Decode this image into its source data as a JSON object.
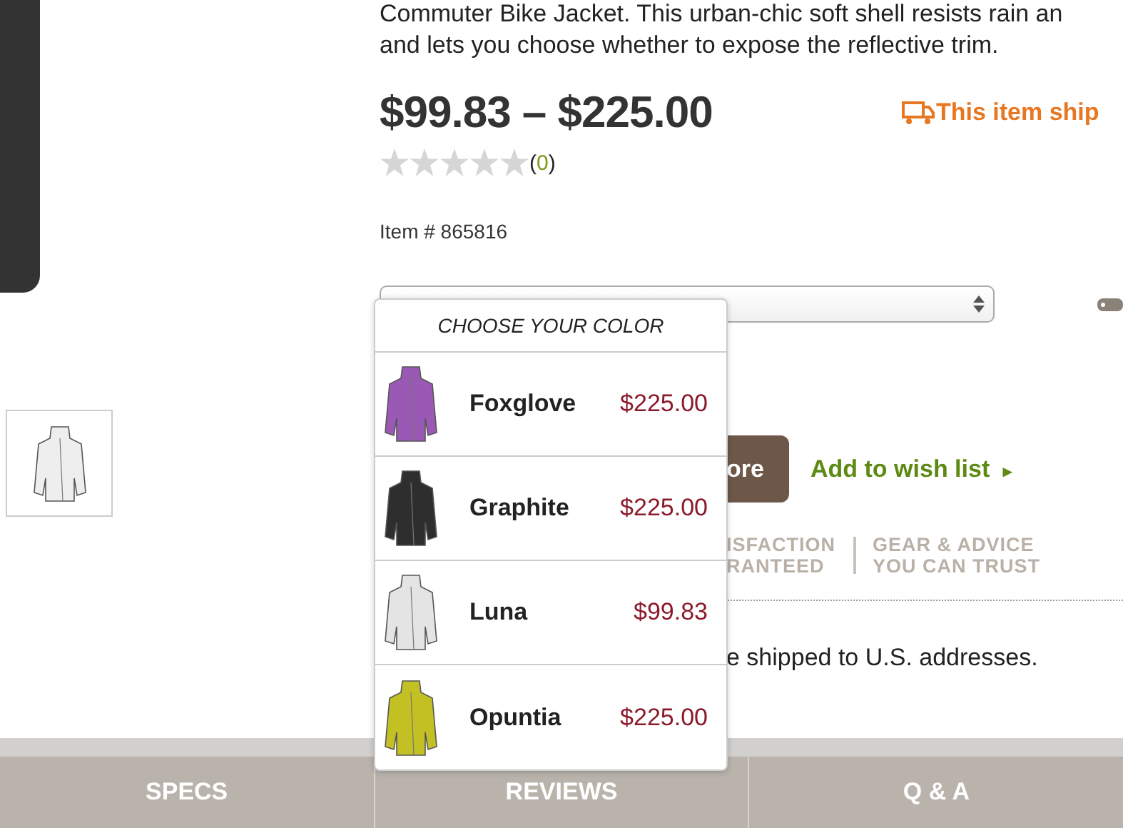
{
  "description": [
    "Commuter Bike Jacket. This urban-chic soft shell resists rain an",
    "and lets you choose whether to expose the reflective trim."
  ],
  "price": "$99.83 – $225.00",
  "shipping_notice": "This item ship",
  "rating": {
    "stars": 0,
    "count_open": "(",
    "count": "0",
    "count_close": ")"
  },
  "item_number": "Item # 865816",
  "cart_button": "ore",
  "wish_list_link": {
    "label": "Add to wish list",
    "arrow": "▸"
  },
  "trust_badges": [
    {
      "lines": [
        "ISFACTION",
        "RANTEED"
      ]
    },
    {
      "lines": [
        "GEAR & ADVICE",
        "YOU CAN TRUST"
      ]
    }
  ],
  "shipping_info": "e shipped to U.S. addresses.",
  "color_picker": {
    "title": "CHOOSE YOUR COLOR",
    "options": [
      {
        "name": "Foxglove",
        "price": "$225.00",
        "color": "#9b59b6"
      },
      {
        "name": "Graphite",
        "price": "$225.00",
        "color": "#2e2e2e"
      },
      {
        "name": "Luna",
        "price": "$99.83",
        "color": "#e4e4e4"
      },
      {
        "name": "Opuntia",
        "price": "$225.00",
        "color": "#c3c023"
      }
    ]
  },
  "tabs": [
    {
      "label": "SPECS",
      "selected": false
    },
    {
      "label": "REVIEWS",
      "selected": false
    },
    {
      "label": "Q & A",
      "selected": false
    }
  ]
}
